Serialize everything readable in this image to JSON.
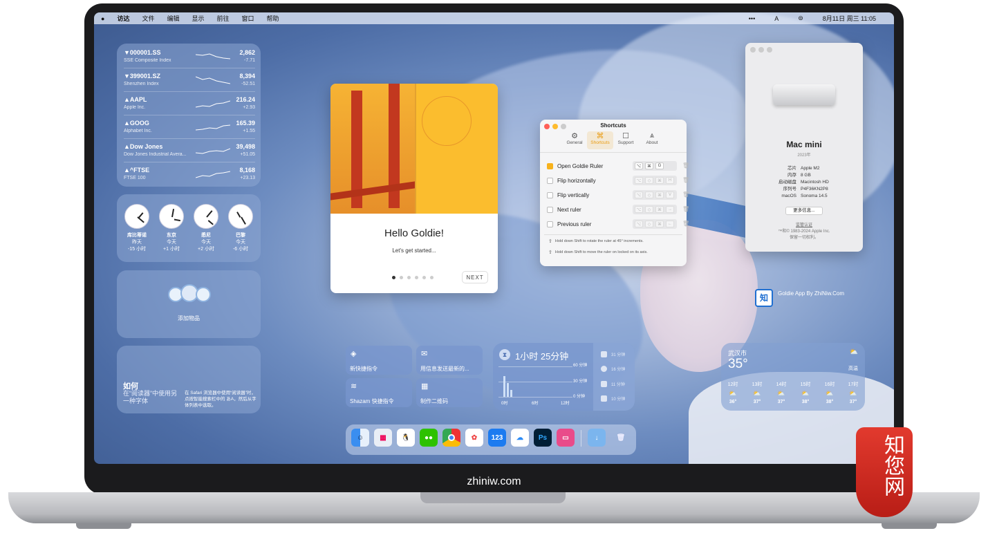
{
  "menubar": {
    "items": [
      "访达",
      "文件",
      "编辑",
      "显示",
      "前往",
      "窗口",
      "帮助"
    ],
    "date_time": "8月11日 周三 11:05"
  },
  "stocks": [
    {
      "symbol": "▼000001.SS",
      "name": "SSE Composite Index",
      "value": "2,862",
      "change": "-7.71"
    },
    {
      "symbol": "▼399001.SZ",
      "name": "Shenzhen Index",
      "value": "8,394",
      "change": "-52.51"
    },
    {
      "symbol": "▲AAPL",
      "name": "Apple Inc.",
      "value": "216.24",
      "change": "+2.93"
    },
    {
      "symbol": "▲GOOG",
      "name": "Alphabet Inc.",
      "value": "165.39",
      "change": "+1.55"
    },
    {
      "symbol": "▲Dow Jones",
      "name": "Dow Jones Industrial Avera...",
      "value": "39,498",
      "change": "+51.05"
    },
    {
      "symbol": "▲^FTSE",
      "name": "FTSE 100",
      "value": "8,168",
      "change": "+23.13"
    }
  ],
  "clocks": [
    {
      "city": "库比蒂诺",
      "day": "昨天",
      "offset": "-15 小时"
    },
    {
      "city": "东京",
      "day": "今天",
      "offset": "+1 小时"
    },
    {
      "city": "悉尼",
      "day": "今天",
      "offset": "+2 小时"
    },
    {
      "city": "巴黎",
      "day": "今天",
      "offset": "-6 小时"
    }
  ],
  "add_widget": {
    "label": "添加物品"
  },
  "tips": {
    "title": "如何",
    "subtitle": "在“阅读器”中使用另一种字体",
    "body": "在 Safari 浏览器中使用“阅读器”时，点按智能搜索栏中的 あA，然后从字体列表中选取。"
  },
  "welcome": {
    "title": "Hello Goldie!",
    "subtitle": "Let's get started...",
    "next": "NEXT"
  },
  "shortcuts": {
    "title": "Shortcuts",
    "tabs": [
      "General",
      "Shortcuts",
      "Support",
      "About"
    ],
    "rows": [
      {
        "label": "Open Goldie Ruler",
        "checked": true,
        "keys": [
          "⌥",
          "⌘",
          "G"
        ]
      },
      {
        "label": "Flip horizontally",
        "checked": false,
        "keys": [
          "⌥",
          "◇",
          "⌘",
          "H"
        ]
      },
      {
        "label": "Flip vertically",
        "checked": false,
        "keys": [
          "⌥",
          "◇",
          "⌘",
          "V"
        ]
      },
      {
        "label": "Next ruler",
        "checked": false,
        "keys": [
          "⌥",
          "◇",
          "⌘",
          "→"
        ]
      },
      {
        "label": "Previous ruler",
        "checked": false,
        "keys": [
          "⌥",
          "◇",
          "⌘",
          "←"
        ]
      }
    ],
    "hints": [
      "Hold down Shift to rotate the ruler at 45° increments.",
      "Hold down Shift to move the ruler on locked on its axis."
    ]
  },
  "about_mac": {
    "model": "Mac mini",
    "year": "2023年",
    "specs": [
      [
        "芯片",
        "Apple M2"
      ],
      [
        "内存",
        "8 GB"
      ],
      [
        "启动磁盘",
        "Macintosh HD"
      ],
      [
        "序列号",
        "P4F36KN2P8"
      ],
      [
        "macOS",
        "Sonoma 14.5"
      ]
    ],
    "more_info": "更多信息...",
    "regulatory": "监管认证",
    "copyright": "™和© 1983-2024 Apple Inc.",
    "rights": "保留一切权利。"
  },
  "desktop_icon": {
    "label": "Goldie App By ZhiNiw.Com"
  },
  "shortcut_tiles": [
    "新快捷指令",
    "用信息发送最新的...",
    "Shazam 快捷指令",
    "制作二维码"
  ],
  "screen_time": {
    "total": "1小时 25分钟",
    "axis": [
      "60 分钟",
      "30 分钟",
      "0 分钟"
    ],
    "x_labels": [
      "0时",
      "6时",
      "12时"
    ],
    "apps": [
      "31 分钟",
      "16 分钟",
      "11 分钟",
      "10 分钟"
    ]
  },
  "weather": {
    "city": "武汉市",
    "temp": "35°",
    "condition": "高温",
    "hours": [
      {
        "time": "12时",
        "temp": "36°"
      },
      {
        "time": "13时",
        "temp": "37°"
      },
      {
        "time": "14时",
        "temp": "37°"
      },
      {
        "time": "15时",
        "temp": "38°"
      },
      {
        "time": "16时",
        "temp": "38°"
      },
      {
        "time": "17时",
        "temp": "37°"
      }
    ]
  },
  "footer": {
    "site": "zhiniw.com"
  },
  "seal": {
    "text": "知您网"
  },
  "watermark": "知您网 ZHINIW.COM"
}
